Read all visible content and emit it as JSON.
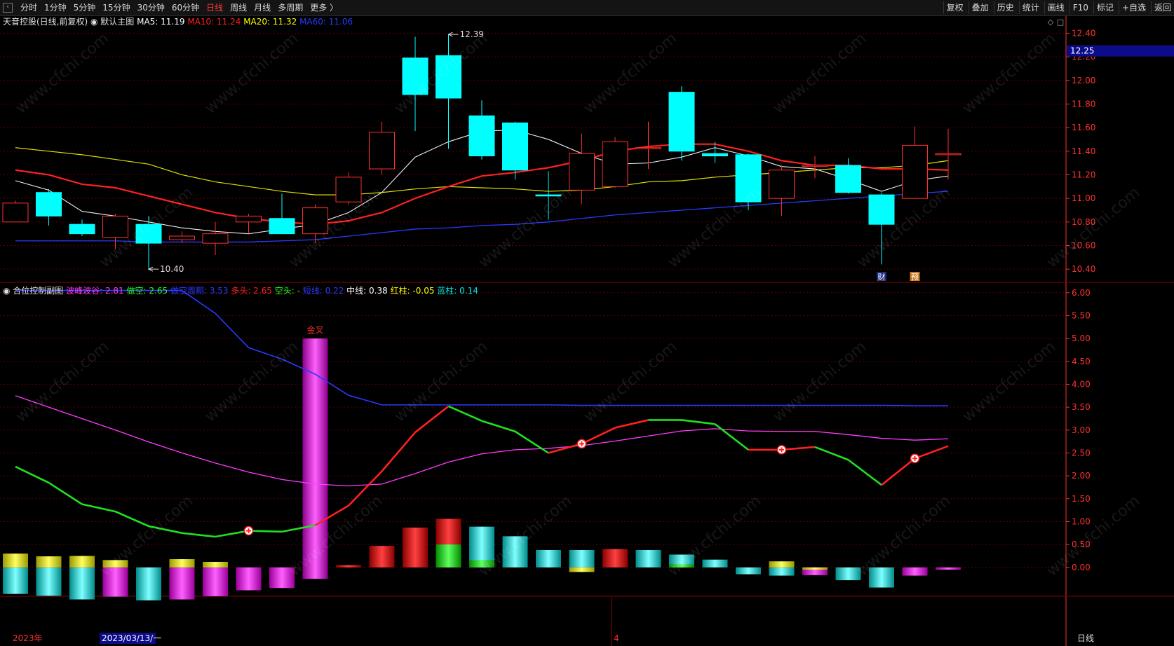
{
  "toolbar": {
    "periods": [
      "分时",
      "1分钟",
      "5分钟",
      "15分钟",
      "30分钟",
      "60分钟",
      "日线",
      "周线",
      "月线",
      "多周期",
      "更多 〉"
    ],
    "active_period": "日线",
    "right_buttons": [
      "复权",
      "叠加",
      "历史",
      "统计",
      "画线",
      "F10",
      "标记",
      "+自选",
      "返回"
    ]
  },
  "main_legend": {
    "stock": "天音控股(日线,前复权)",
    "template": "默认主图",
    "items": [
      {
        "label": "MA5: 11.19",
        "color": "#ffffff"
      },
      {
        "label": "MA10: 11.24",
        "color": "#ff2020"
      },
      {
        "label": "MA20: 11.32",
        "color": "#ffff00"
      },
      {
        "label": "MA60: 11.06",
        "color": "#2a3aff"
      }
    ]
  },
  "sub_legend": {
    "title": "合位控制副图",
    "items": [
      {
        "label": "波峰波谷: 2.81",
        "color": "#ff3cff"
      },
      {
        "label": "做空: 2.65",
        "color": "#20ff20"
      },
      {
        "label": "做空周期: 3.53",
        "color": "#2a3aff"
      },
      {
        "label": "多头: 2.65",
        "color": "#ff2020"
      },
      {
        "label": "空头: -",
        "color": "#20ff20"
      },
      {
        "label": "短线: 0.22",
        "color": "#2a3aff"
      },
      {
        "label": "中线: 0.38",
        "color": "#ffffff"
      },
      {
        "label": "红柱: -0.05",
        "color": "#ffff00"
      },
      {
        "label": "蓝柱: 0.14",
        "color": "#00e5e5"
      }
    ]
  },
  "price_axis": {
    "ticks": [
      "12.40",
      "12.20",
      "12.00",
      "11.80",
      "11.60",
      "11.40",
      "11.20",
      "11.00",
      "10.80",
      "10.60",
      "10.40"
    ],
    "current_price": "12.25",
    "high_label": "12.39",
    "low_label": "10.40"
  },
  "sub_axis": {
    "ticks": [
      "6.00",
      "5.50",
      "5.00",
      "4.50",
      "4.00",
      "3.50",
      "3.00",
      "2.50",
      "2.00",
      "1.50",
      "1.00",
      "0.50",
      "0.00"
    ]
  },
  "annotations": {
    "golden_cross": "金叉",
    "badge_cai": "财",
    "badge_yu": "预"
  },
  "date_bar": {
    "year": "2023年",
    "cursor_date": "2023/03/13/一",
    "month_mark": "4",
    "period_label": "日线"
  },
  "colors": {
    "up": "#ff3030",
    "down": "#00ffff",
    "grid": "#5a0000",
    "axis": "#ff3030"
  },
  "chart_data": {
    "type": "candlestick",
    "ylim": [
      10.3,
      12.45
    ],
    "candles": [
      {
        "o": 10.8,
        "h": 10.98,
        "l": 10.8,
        "c": 10.96
      },
      {
        "o": 11.05,
        "h": 11.08,
        "l": 10.77,
        "c": 10.85
      },
      {
        "o": 10.78,
        "h": 10.82,
        "l": 10.68,
        "c": 10.7
      },
      {
        "o": 10.67,
        "h": 10.87,
        "l": 10.57,
        "c": 10.85
      },
      {
        "o": 10.78,
        "h": 10.85,
        "l": 10.4,
        "c": 10.62
      },
      {
        "o": 10.65,
        "h": 10.72,
        "l": 10.62,
        "c": 10.68
      },
      {
        "o": 10.62,
        "h": 10.8,
        "l": 10.52,
        "c": 10.7
      },
      {
        "o": 10.8,
        "h": 10.87,
        "l": 10.7,
        "c": 10.85
      },
      {
        "o": 10.83,
        "h": 11.04,
        "l": 10.7,
        "c": 10.7
      },
      {
        "o": 10.7,
        "h": 10.95,
        "l": 10.62,
        "c": 10.92
      },
      {
        "o": 10.97,
        "h": 11.22,
        "l": 10.95,
        "c": 11.18
      },
      {
        "o": 11.25,
        "h": 11.65,
        "l": 11.2,
        "c": 11.56
      },
      {
        "o": 12.19,
        "h": 12.37,
        "l": 11.57,
        "c": 11.88
      },
      {
        "o": 12.21,
        "h": 12.39,
        "l": 11.42,
        "c": 11.85
      },
      {
        "o": 11.7,
        "h": 11.83,
        "l": 11.33,
        "c": 11.36
      },
      {
        "o": 11.64,
        "h": 11.65,
        "l": 11.16,
        "c": 11.24
      },
      {
        "o": 11.03,
        "h": 11.23,
        "l": 10.82,
        "c": 11.02
      },
      {
        "o": 11.07,
        "h": 11.55,
        "l": 10.95,
        "c": 11.38
      },
      {
        "o": 11.1,
        "h": 11.52,
        "l": 11.09,
        "c": 11.48
      },
      {
        "o": 11.42,
        "h": 11.65,
        "l": 11.25,
        "c": 11.43
      },
      {
        "o": 11.9,
        "h": 11.95,
        "l": 11.32,
        "c": 11.4
      },
      {
        "o": 11.38,
        "h": 11.48,
        "l": 11.3,
        "c": 11.36
      },
      {
        "o": 11.37,
        "h": 11.38,
        "l": 10.9,
        "c": 10.97
      },
      {
        "o": 11.0,
        "h": 11.28,
        "l": 10.85,
        "c": 11.24
      },
      {
        "o": 11.27,
        "h": 11.36,
        "l": 11.17,
        "c": 11.28
      },
      {
        "o": 11.28,
        "h": 11.34,
        "l": 11.04,
        "c": 11.05
      },
      {
        "o": 11.03,
        "h": 11.05,
        "l": 10.44,
        "c": 10.78
      },
      {
        "o": 11.0,
        "h": 11.61,
        "l": 11.0,
        "c": 11.45
      },
      {
        "o": 11.37,
        "h": 11.59,
        "l": 11.16,
        "c": 11.38
      }
    ],
    "ma5": [
      11.15,
      11.07,
      10.89,
      10.85,
      10.8,
      10.75,
      10.72,
      10.7,
      10.74,
      10.78,
      10.88,
      11.05,
      11.35,
      11.48,
      11.57,
      11.58,
      11.5,
      11.38,
      11.29,
      11.3,
      11.35,
      11.43,
      11.36,
      11.27,
      11.25,
      11.16,
      11.06,
      11.15,
      11.19
    ],
    "ma10": [
      11.24,
      11.2,
      11.12,
      11.09,
      11.02,
      10.95,
      10.88,
      10.83,
      10.8,
      10.78,
      10.81,
      10.88,
      11.0,
      11.1,
      11.19,
      11.22,
      11.26,
      11.32,
      11.4,
      11.44,
      11.46,
      11.46,
      11.4,
      11.32,
      11.28,
      11.28,
      11.25,
      11.25,
      11.24
    ],
    "ma20": [
      11.43,
      11.4,
      11.37,
      11.33,
      11.29,
      11.2,
      11.14,
      11.1,
      11.06,
      11.03,
      11.03,
      11.05,
      11.08,
      11.1,
      11.09,
      11.08,
      11.06,
      11.07,
      11.1,
      11.14,
      11.15,
      11.18,
      11.2,
      11.22,
      11.24,
      11.26,
      11.26,
      11.28,
      11.32
    ],
    "ma60": [
      10.64,
      10.64,
      10.64,
      10.64,
      10.63,
      10.63,
      10.63,
      10.63,
      10.64,
      10.65,
      10.68,
      10.71,
      10.74,
      10.75,
      10.77,
      10.78,
      10.8,
      10.83,
      10.86,
      10.88,
      10.9,
      10.92,
      10.94,
      10.96,
      10.98,
      11.0,
      11.02,
      11.04,
      11.06
    ],
    "sub": {
      "ylim": [
        -0.6,
        6.15
      ],
      "wave": [
        3.75,
        3.5,
        3.25,
        3.0,
        2.74,
        2.5,
        2.28,
        2.08,
        1.92,
        1.82,
        1.78,
        1.82,
        2.05,
        2.3,
        2.48,
        2.57,
        2.6,
        2.66,
        2.76,
        2.87,
        2.98,
        3.03,
        2.98,
        2.97,
        2.97,
        2.9,
        2.82,
        2.78,
        2.81
      ],
      "short_line": [
        2.2,
        1.85,
        1.38,
        1.22,
        0.9,
        0.75,
        0.67,
        0.8,
        0.78,
        0.92,
        1.35,
        2.1,
        2.95,
        3.52,
        3.2,
        2.97,
        2.5,
        2.7,
        3.05,
        3.22,
        3.22,
        3.13,
        2.57,
        2.57,
        2.63,
        2.35,
        1.8,
        2.38,
        2.65
      ],
      "short_up": [
        false,
        false,
        false,
        false,
        false,
        false,
        false,
        false,
        false,
        false,
        true,
        true,
        true,
        true,
        false,
        false,
        false,
        true,
        true,
        true,
        false,
        false,
        false,
        true,
        true,
        false,
        false,
        true,
        true
      ],
      "cycle": [
        6.05,
        6.05,
        6.05,
        6.05,
        6.05,
        6.05,
        5.55,
        4.8,
        4.55,
        4.22,
        3.76,
        3.55,
        3.55,
        3.55,
        3.55,
        3.55,
        3.55,
        3.54,
        3.54,
        3.54,
        3.54,
        3.54,
        3.54,
        3.54,
        3.54,
        3.54,
        3.54,
        3.53,
        3.53
      ],
      "bars": [
        {
          "t": "yc",
          "v": -0.58,
          "y": 0.3
        },
        {
          "t": "yc",
          "v": -0.62,
          "y": 0.24
        },
        {
          "t": "yc",
          "v": -0.7,
          "y": 0.25
        },
        {
          "t": "ym",
          "v": -0.64,
          "y": 0.16
        },
        {
          "t": "c",
          "v": -0.72
        },
        {
          "t": "ym",
          "v": -0.7,
          "y": 0.18
        },
        {
          "t": "ym",
          "v": -0.63,
          "y": 0.12
        },
        {
          "t": "m",
          "v": -0.5
        },
        {
          "t": "m",
          "v": -0.45
        },
        {
          "t": "golden",
          "v": 5.0,
          "n": -0.25
        },
        {
          "t": "r",
          "v": 0.05
        },
        {
          "t": "r",
          "v": 0.47
        },
        {
          "t": "r",
          "v": 0.87
        },
        {
          "t": "rg",
          "v": 1.06,
          "g": 0.5
        },
        {
          "t": "cg",
          "v": 0.89,
          "g": 0.16
        },
        {
          "t": "c",
          "v": 0.68
        },
        {
          "t": "c",
          "v": 0.38
        },
        {
          "t": "cy",
          "v": 0.38,
          "y": -0.1
        },
        {
          "t": "r",
          "v": 0.4
        },
        {
          "t": "c",
          "v": 0.38
        },
        {
          "t": "cg",
          "v": 0.28,
          "g": 0.07
        },
        {
          "t": "c",
          "v": 0.17
        },
        {
          "t": "c",
          "v": -0.15
        },
        {
          "t": "yc",
          "v": -0.18,
          "y": 0.13
        },
        {
          "t": "ymn",
          "v": -0.17,
          "y": 0.07
        },
        {
          "t": "c",
          "v": -0.28
        },
        {
          "t": "c",
          "v": -0.44
        },
        {
          "t": "m",
          "v": -0.18
        },
        {
          "t": "m",
          "v": -0.05
        }
      ],
      "markers": [
        7,
        17,
        23,
        27
      ]
    }
  }
}
